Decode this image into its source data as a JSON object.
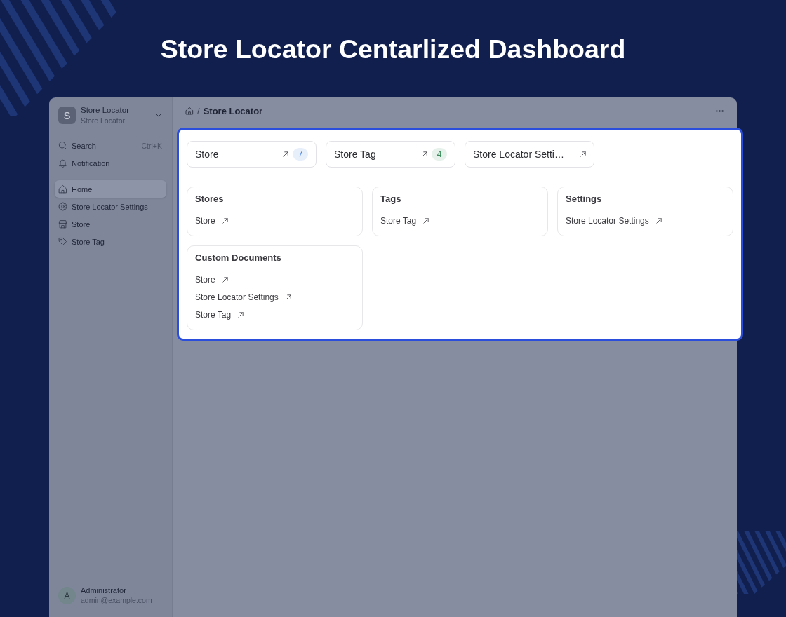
{
  "page": {
    "title": "Store Locator Centarlized Dashboard"
  },
  "sidebar": {
    "app": {
      "initial": "S",
      "name": "Store Locator",
      "subtitle": "Store Locator"
    },
    "actions": [
      {
        "kind": "search",
        "label": "Search",
        "shortcut": "Ctrl+K"
      },
      {
        "kind": "notification",
        "label": "Notification"
      }
    ],
    "items": [
      {
        "kind": "home",
        "label": "Home",
        "selected": true
      },
      {
        "kind": "settings",
        "label": "Store Locator Settings",
        "selected": false
      },
      {
        "kind": "store",
        "label": "Store",
        "selected": false
      },
      {
        "kind": "tag",
        "label": "Store Tag",
        "selected": false
      }
    ],
    "user": {
      "initial": "A",
      "name": "Administrator",
      "email": "admin@example.com"
    }
  },
  "breadcrumb": {
    "separator": "/",
    "current": "Store Locator"
  },
  "shortcuts": [
    {
      "label": "Store",
      "count": "7",
      "color": "#3b7ddf"
    },
    {
      "label": "Store Tag",
      "count": "4",
      "color": "#3a8a5b"
    },
    {
      "label": "Store Locator Setti…"
    }
  ],
  "sections": [
    {
      "title": "Stores",
      "links": [
        "Store"
      ]
    },
    {
      "title": "Tags",
      "links": [
        "Store Tag"
      ]
    },
    {
      "title": "Settings",
      "links": [
        "Store Locator Settings"
      ]
    },
    {
      "title": "Custom Documents",
      "links": [
        "Store",
        "Store Locator Settings",
        "Store Tag"
      ]
    }
  ]
}
